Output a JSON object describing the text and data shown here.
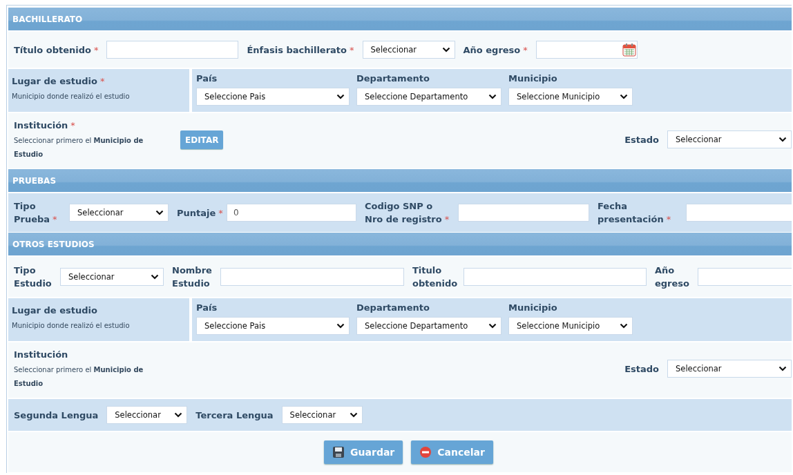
{
  "sections": [
    {
      "title": "BACHILLERATO",
      "rows": [
        {
          "kind": "fields",
          "shaded": false,
          "fields": [
            {
              "label": "Título obtenido",
              "asterisk": "*",
              "kind": "text"
            },
            {
              "label": "Énfasis bachillerato",
              "asterisk": "*",
              "kind": "select",
              "value": "Seleccionar"
            },
            {
              "label": "Año egreso",
              "asterisk": "*",
              "kind": "date"
            }
          ]
        },
        {
          "kind": "place",
          "shaded": true,
          "label": "Lugar de estudio",
          "asterisk": "*",
          "hint": "Municipio donde realizó el estudio",
          "selects": [
            {
              "label": "País",
              "value": "Seleccione Pais"
            },
            {
              "label": "Departamento",
              "value": "Seleccione Departamento"
            },
            {
              "label": "Municipio",
              "value": "Seleccione Municipio"
            }
          ]
        },
        {
          "kind": "institution",
          "shaded": false,
          "label": "Institución",
          "asterisk": "*",
          "hint": "Seleccionar primero el **Municipio de Estudio**",
          "button": "EDITAR",
          "status": {
            "label": "Estado",
            "value": "Seleccionar"
          }
        }
      ]
    },
    {
      "title": "PRUEBAS",
      "rows": [
        {
          "kind": "fields",
          "shaded": true,
          "fields": [
            {
              "label": "Tipo Prueba",
              "asterisk": "*",
              "kind": "select",
              "value": "Seleccionar"
            },
            {
              "label": "Puntaje",
              "asterisk": "*",
              "kind": "text",
              "value": "0"
            },
            {
              "label": "Codigo SNP o Nro de registro",
              "asterisk": "*",
              "kind": "text"
            },
            {
              "label": "Fecha presentación",
              "asterisk": "*",
              "kind": "date"
            }
          ]
        }
      ]
    },
    {
      "title": "OTROS ESTUDIOS",
      "rows": [
        {
          "kind": "fields",
          "shaded": false,
          "fields": [
            {
              "label": "Tipo Estudio",
              "kind": "select",
              "value": "Seleccionar"
            },
            {
              "label": "Nombre Estudio",
              "kind": "text"
            },
            {
              "label": "Titulo obtenido",
              "kind": "text"
            },
            {
              "label": "Año egreso",
              "kind": "date"
            }
          ]
        },
        {
          "kind": "place",
          "shaded": true,
          "label": "Lugar de estudio",
          "hint": "Municipio donde realizó el estudio",
          "selects": [
            {
              "label": "País",
              "value": "Seleccione Pais"
            },
            {
              "label": "Departamento",
              "value": "Seleccione Departamento"
            },
            {
              "label": "Municipio",
              "value": "Seleccione Municipio"
            }
          ]
        },
        {
          "kind": "institution",
          "shaded": false,
          "label": "Institución",
          "hint": "Seleccionar primero el **Municipio de Estudio**",
          "status": {
            "label": "Estado",
            "value": "Seleccionar"
          }
        },
        {
          "kind": "fields",
          "shaded": true,
          "fields": [
            {
              "label": "Segunda Lengua",
              "kind": "select",
              "value": "Seleccionar"
            },
            {
              "label": "Tercera Lengua",
              "kind": "select",
              "value": "Seleccionar"
            }
          ]
        }
      ]
    }
  ],
  "actions": [
    {
      "kind": "save",
      "label": "Guardar"
    },
    {
      "kind": "cancel",
      "label": "Cancelar"
    }
  ]
}
